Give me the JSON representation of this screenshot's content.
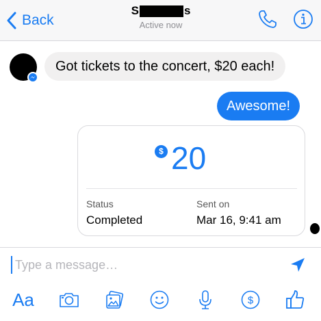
{
  "colors": {
    "accent": "#1a7cf2",
    "incoming_bubble": "#f1f0f0",
    "muted_text": "#8e8e93",
    "placeholder": "#b5b5ba"
  },
  "header": {
    "back_label": "Back",
    "back_icon": "chevron-left-icon",
    "contact_name_start": "S",
    "contact_name_end": "s",
    "status": "Active now",
    "phone_icon": "phone-icon",
    "info_icon": "info-icon"
  },
  "messages": [
    {
      "direction": "incoming",
      "text": "Got tickets to the concert, $20 each!"
    },
    {
      "direction": "outgoing",
      "text": "Awesome!"
    }
  ],
  "payment": {
    "currency_symbol": "$",
    "amount": "20",
    "status_label": "Status",
    "status_value": "Completed",
    "sent_label": "Sent on",
    "sent_value": "Mar 16, 9:41 am"
  },
  "composer": {
    "placeholder": "Type a message…",
    "value": "",
    "send_icon": "send-icon",
    "toolbar": [
      {
        "name": "text-format",
        "label": "Aa"
      },
      {
        "name": "camera",
        "icon": "camera-icon"
      },
      {
        "name": "gallery",
        "icon": "gallery-icon"
      },
      {
        "name": "emoji",
        "icon": "emoji-icon"
      },
      {
        "name": "microphone",
        "icon": "microphone-icon"
      },
      {
        "name": "payment",
        "icon": "dollar-icon"
      },
      {
        "name": "like",
        "icon": "thumbs-up-icon"
      }
    ]
  }
}
